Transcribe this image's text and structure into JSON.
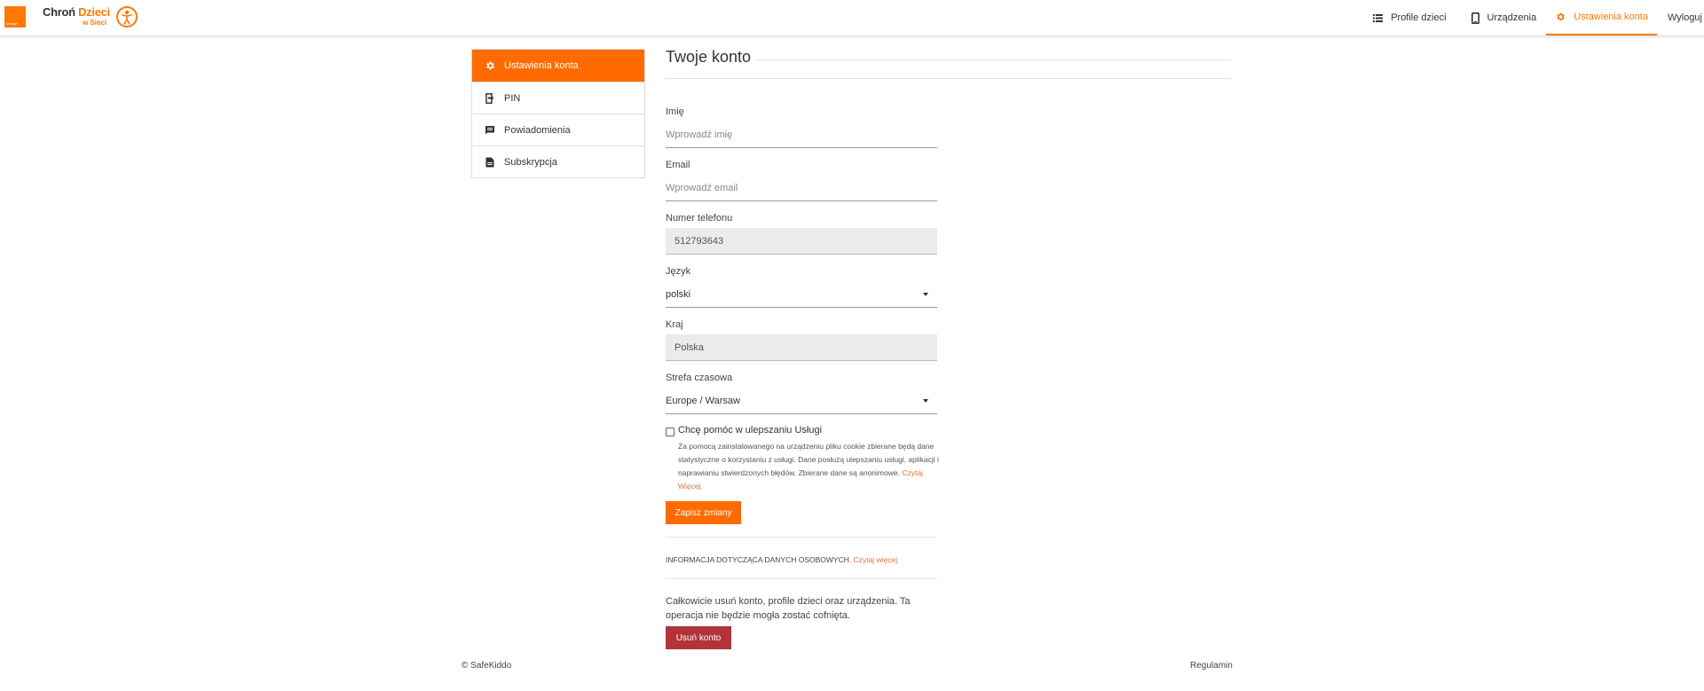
{
  "brand": {
    "orange_logo_text": "orange",
    "name_part1": "Chroń ",
    "name_part2": "Dzieci",
    "name_line2": "w Sieci"
  },
  "nav": {
    "items": [
      {
        "label": "Profile dzieci",
        "icon": "list-icon"
      },
      {
        "label": "Urządzenia",
        "icon": "phone-icon"
      },
      {
        "label": "Ustawienia konta",
        "icon": "gear-icon",
        "active": true
      }
    ],
    "logout": "Wyloguj",
    "accent": "#ff7900"
  },
  "sidebar": {
    "items": [
      {
        "label": "Ustawienia konta",
        "icon": "gear-icon",
        "active": true
      },
      {
        "label": "PIN",
        "icon": "pin-icon"
      },
      {
        "label": "Powiadomienia",
        "icon": "message-icon"
      },
      {
        "label": "Subskrypcja",
        "icon": "document-icon"
      }
    ]
  },
  "main": {
    "title": "Twoje konto",
    "name": {
      "label": "Imię",
      "placeholder": "Wprowadź imię",
      "value": ""
    },
    "email": {
      "label": "Email",
      "placeholder": "Wprowadź email",
      "value": ""
    },
    "phone": {
      "label": "Numer telefonu",
      "value": "512793643"
    },
    "language": {
      "label": "Język",
      "value": "polski"
    },
    "country": {
      "label": "Kraj",
      "value": "Polska"
    },
    "timezone": {
      "label": "Strefa czasowa",
      "value": "Europe / Warsaw"
    },
    "improve": {
      "label": "Chcę pomóc w ulepszaniu Usługi",
      "checked": false,
      "description": "Za pomocą zainstalowanego na urządzeniu pliku cookie zbierane będą dane statystyczne o korzystaniu z usługi. Dane posłużą ulepszaniu usługi, aplikacji i naprawianiu stwierdzonych błędów. Zbierane dane są anonimowe. ",
      "read_more": "Czytaj Więcej."
    },
    "save_button": "Zapisz zmiany",
    "personal_info": "INFORMACJA DOTYCZĄCA DANYCH OSOBOWYCH. ",
    "personal_info_link": "Czytaj więcej",
    "delete_text": "Całkowicie usuń konto, profile dzieci oraz urządzenia. Ta operacja nie będzie mogła zostać cofnięta.",
    "delete_button": "Usuń konto",
    "danger_color": "#b3333a"
  },
  "footer": {
    "copyright": "© SafeKiddo",
    "terms": "Regulamin"
  }
}
